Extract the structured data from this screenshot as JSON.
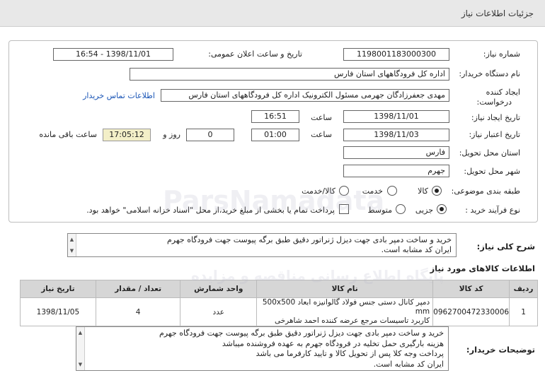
{
  "header": {
    "title": "جزئیات اطلاعات نیاز"
  },
  "form": {
    "need_number_label": "شماره نیاز:",
    "need_number": "1198001183000300",
    "announce_label": "تاریخ و ساعت اعلان عمومی:",
    "announce_value": "1398/11/01 - 16:54",
    "buyer_label": "نام دستگاه خریدار:",
    "buyer_value": "اداره کل فرودگاههای استان فارس",
    "creator_label_1": "ایجاد کننده",
    "creator_label_2": "درخواست:",
    "creator_value": "مهدی جعفرزادگان جهرمی مسئول الکترونیک اداره کل فرودگاههای استان فارس",
    "contact_link": "اطلاعات تماس خریدار",
    "created_date_label": "تاریخ ایجاد نیاز:",
    "created_date": "1398/11/01",
    "time_label": "ساعت",
    "created_time": "16:51",
    "validity_label": "تاریخ اعتبار نیاز:",
    "validity_date": "1398/11/03",
    "validity_time": "01:00",
    "days_value": "0",
    "days_label": "روز و",
    "remaining_time": "17:05:12",
    "remaining_label": "ساعت باقی مانده",
    "province_label": "استان محل تحویل:",
    "province_value": "فارس",
    "city_label": "شهر محل تحویل:",
    "city_value": "جهرم",
    "category_label": "طبقه بندی موضوعی:",
    "category_options": [
      "کالا",
      "خدمت",
      "کالا/خدمت"
    ],
    "category_selected": "کالا",
    "process_label": "نوع فرآیند خرید :",
    "process_options": [
      "جزیی",
      "متوسط"
    ],
    "process_selected": "جزیی",
    "payment_note": "پرداخت تمام یا بخشی از مبلغ خرید،از محل \"اسناد خزانه اسلامی\" خواهد بود."
  },
  "summary": {
    "label": "شرح کلی نیاز:",
    "line1": "خرید و ساخت دمپر بادی جهت دیزل ژنراتور دقیق طبق برگه پیوست جهت فرودگاه جهرم",
    "line2": "ایران کد مشابه است."
  },
  "items_section_title": "اطلاعات کالاهای مورد نیاز",
  "table": {
    "headers": [
      "ردیف",
      "کد کالا",
      "نام کالا",
      "واحد شمارش",
      "تعداد / مقدار",
      "تاریخ نیاز"
    ],
    "rows": [
      {
        "row": "1",
        "code": "0962700472330006",
        "name_line1": "دمپر کانال دستی جنس فولاد گالوانیزه ابعاد 500x500 mm",
        "name_line2": "کاربرد تاسیسات مرجع عرضه کننده احمد شاهرخی",
        "unit": "عدد",
        "qty": "4",
        "date": "1398/11/05"
      }
    ]
  },
  "buyer_notes": {
    "label": "توضیحات خریدار:",
    "lines": [
      "خرید و ساخت دمپر بادی جهت دیزل ژنراتور دقیق طبق برگه پیوست جهت فرودگاه جهرم",
      "هزینه بارگیری حمل تخلیه در فرودگاه جهرم به عهده فروشنده میباشد",
      "پرداخت وجه کلا پس از تحویل کالا و تایید کارفرما می باشد",
      "ایران کد مشابه است."
    ]
  },
  "watermark": {
    "brand": "ParsNamadata",
    "slogan": "پایگاه اطلاع رسانی مناقصه و مزایده"
  }
}
